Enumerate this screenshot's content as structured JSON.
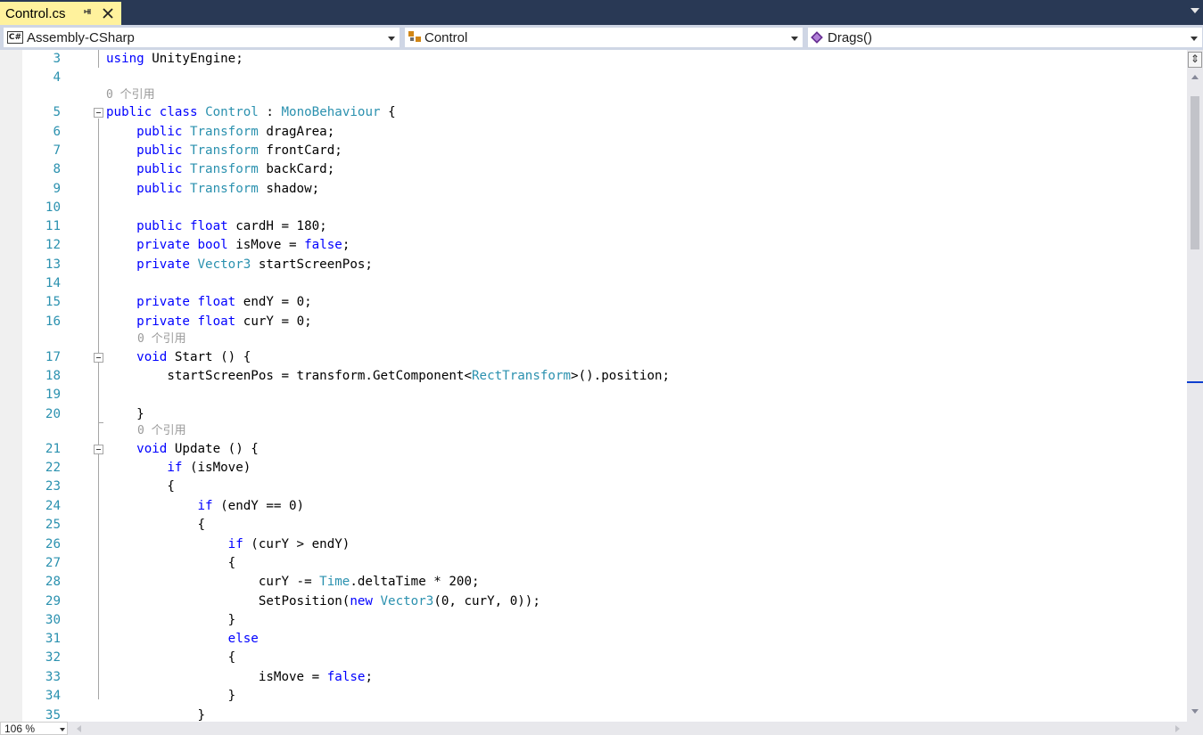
{
  "tab": {
    "title": "Control.cs",
    "pin_icon": "pin-icon",
    "close_glyph": "✕"
  },
  "nav": {
    "project": "Assembly-CSharp",
    "project_icon_text": "C#",
    "class": "Control",
    "member": "Drags()"
  },
  "code_lines": [
    {
      "num": "3",
      "html": "<span class=\"kw\">using</span> UnityEngine;"
    },
    {
      "num": "4",
      "html": ""
    },
    {
      "num": "5",
      "html": "<span class=\"kw\">public</span> <span class=\"kw\">class</span> <span class=\"ty\">Control</span> : <span class=\"ty\">MonoBehaviour</span> {"
    },
    {
      "num": "6",
      "html": "    <span class=\"kw\">public</span> <span class=\"ty\">Transform</span> dragArea;"
    },
    {
      "num": "7",
      "html": "    <span class=\"kw\">public</span> <span class=\"ty\">Transform</span> frontCard;"
    },
    {
      "num": "8",
      "html": "    <span class=\"kw\">public</span> <span class=\"ty\">Transform</span> backCard;"
    },
    {
      "num": "9",
      "html": "    <span class=\"kw\">public</span> <span class=\"ty\">Transform</span> shadow;"
    },
    {
      "num": "10",
      "html": ""
    },
    {
      "num": "11",
      "html": "    <span class=\"kw\">public</span> <span class=\"kw\">float</span> cardH = 180;"
    },
    {
      "num": "12",
      "html": "    <span class=\"kw\">private</span> <span class=\"kw\">bool</span> isMove = <span class=\"kw\">false</span>;"
    },
    {
      "num": "13",
      "html": "    <span class=\"kw\">private</span> <span class=\"ty\">Vector3</span> startScreenPos;"
    },
    {
      "num": "14",
      "html": ""
    },
    {
      "num": "15",
      "html": "    <span class=\"kw\">private</span> <span class=\"kw\">float</span> endY = 0;"
    },
    {
      "num": "16",
      "html": "    <span class=\"kw\">private</span> <span class=\"kw\">float</span> curY = 0;"
    },
    {
      "num": "17",
      "html": "    <span class=\"kw\">void</span> Start () {"
    },
    {
      "num": "18",
      "html": "        startScreenPos = transform.GetComponent&lt;<span class=\"ty\">RectTransform</span>&gt;().position;"
    },
    {
      "num": "19",
      "html": ""
    },
    {
      "num": "20",
      "html": "    }"
    },
    {
      "num": "21",
      "html": "    <span class=\"kw\">void</span> Update () {"
    },
    {
      "num": "22",
      "html": "        <span class=\"kw\">if</span> (isMove)"
    },
    {
      "num": "23",
      "html": "        {"
    },
    {
      "num": "24",
      "html": "            <span class=\"kw\">if</span> (endY == 0)"
    },
    {
      "num": "25",
      "html": "            {"
    },
    {
      "num": "26",
      "html": "                <span class=\"kw\">if</span> (curY &gt; endY)"
    },
    {
      "num": "27",
      "html": "                {"
    },
    {
      "num": "28",
      "html": "                    curY -= <span class=\"ty\">Time</span>.deltaTime * 200;"
    },
    {
      "num": "29",
      "html": "                    SetPosition(<span class=\"kw\">new</span> <span class=\"ty\">Vector3</span>(0, curY, 0));"
    },
    {
      "num": "30",
      "html": "                }"
    },
    {
      "num": "31",
      "html": "                <span class=\"kw\">else</span>"
    },
    {
      "num": "32",
      "html": "                {"
    },
    {
      "num": "33",
      "html": "                    isMove = <span class=\"kw\">false</span>;"
    },
    {
      "num": "34",
      "html": "                }"
    },
    {
      "num": "35",
      "html": "            }"
    }
  ],
  "ref_hint": "0 个引用",
  "zoom": "106 %",
  "colors": {
    "keyword": "#0000ff",
    "type": "#2b91af",
    "line_number": "#2b91af",
    "hint": "#999999",
    "tab_active": "#fff29d",
    "titlebar": "#293955"
  }
}
